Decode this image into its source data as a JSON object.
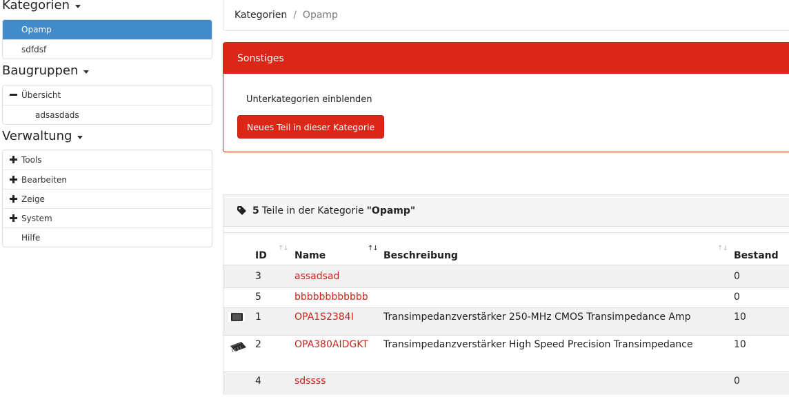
{
  "sidebar": {
    "categories": {
      "title": "Kategorien",
      "items": [
        {
          "label": "Opamp",
          "active": true
        },
        {
          "label": "sdfdsf",
          "active": false
        }
      ]
    },
    "assemblies": {
      "title": "Baugruppen",
      "items": [
        {
          "label": "Übersicht",
          "icon": "minus-icon"
        },
        {
          "label": "adsasdads"
        }
      ]
    },
    "admin": {
      "title": "Verwaltung",
      "items": [
        {
          "label": "Tools",
          "icon": "plus-icon"
        },
        {
          "label": "Bearbeiten",
          "icon": "plus-icon"
        },
        {
          "label": "Zeige",
          "icon": "plus-icon"
        },
        {
          "label": "System",
          "icon": "plus-icon"
        },
        {
          "label": "Hilfe"
        }
      ]
    }
  },
  "breadcrumb": {
    "root": "Kategorien",
    "separator": "/",
    "current": "Opamp"
  },
  "misc_panel": {
    "title": "Sonstiges",
    "toggle_label": "Unterkategorien einblenden",
    "new_part_button": "Neues Teil in dieser Kategorie"
  },
  "parts_panel": {
    "count": "5",
    "text_before": "Teile in der Kategorie",
    "category": "\"Opamp\"",
    "columns": [
      "ID",
      "Name",
      "Beschreibung",
      "Bestand"
    ],
    "sort_glyph": "↑↓",
    "rows": [
      {
        "id": "3",
        "name": "assadsad",
        "description": "",
        "stock": "0",
        "thumb": ""
      },
      {
        "id": "5",
        "name": "bbbbbbbbbbbb",
        "description": "",
        "stock": "0",
        "thumb": ""
      },
      {
        "id": "1",
        "name": "OPA1S2384I",
        "description": "Transimpedanzverstärker 250-MHz CMOS Transimpedance Amp",
        "stock": "10",
        "thumb": "chip-qfn-icon"
      },
      {
        "id": "2",
        "name": "OPA380AIDGKT",
        "description": "Transimpedanzverstärker High Speed Precision Transimpedance",
        "stock": "10",
        "thumb": "chip-msop-icon"
      },
      {
        "id": "4",
        "name": "sdssss",
        "description": "",
        "stock": "0",
        "thumb": ""
      }
    ]
  },
  "colors": {
    "primary": "#428bca",
    "danger": "#db2618",
    "link": "#c9241b"
  }
}
